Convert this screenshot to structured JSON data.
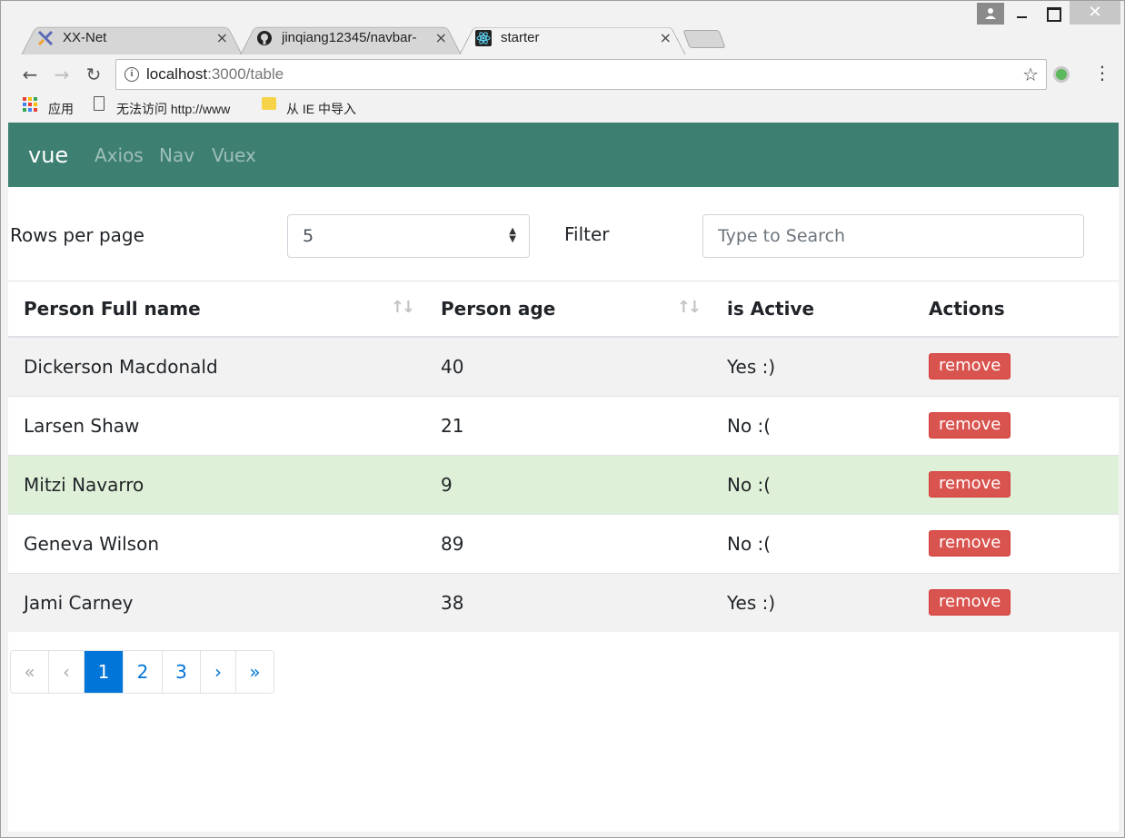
{
  "browser": {
    "tabs": [
      {
        "title": "XX-Net",
        "icon": "xx-net-logo-icon",
        "active": false
      },
      {
        "title": "jinqiang12345/navbar-",
        "icon": "github-icon",
        "active": false
      },
      {
        "title": "starter",
        "icon": "react-atom-icon",
        "active": true
      }
    ],
    "close_glyph": "×",
    "address": {
      "host": "localhost",
      "rest": ":3000/table"
    },
    "bookmarks": [
      {
        "label": "应用",
        "icon": "apps-grid-icon"
      },
      {
        "label": "无法访问 http://www",
        "icon": "page-icon"
      },
      {
        "label": "从 IE 中导入",
        "icon": "folder-icon"
      }
    ]
  },
  "navbar": {
    "brand": "vue",
    "links": [
      "Axios",
      "Nav",
      "Vuex"
    ],
    "color": "#3d7f71"
  },
  "controls": {
    "rows_per_page_label": "Rows per page",
    "rows_per_page_value": "5",
    "filter_label": "Filter",
    "search_placeholder": "Type to Search"
  },
  "table": {
    "headers": [
      "Person Full name",
      "Person age",
      "is Active",
      "Actions"
    ],
    "rows": [
      {
        "name": "Dickerson Macdonald",
        "age": "40",
        "active": "Yes :)",
        "action": "remove",
        "variant": "striped"
      },
      {
        "name": "Larsen Shaw",
        "age": "21",
        "active": "No :(",
        "action": "remove",
        "variant": "plain"
      },
      {
        "name": "Mitzi Navarro",
        "age": "9",
        "active": "No :(",
        "action": "remove",
        "variant": "success"
      },
      {
        "name": "Geneva Wilson",
        "age": "89",
        "active": "No :(",
        "action": "remove",
        "variant": "plain"
      },
      {
        "name": "Jami Carney",
        "age": "38",
        "active": "Yes :)",
        "action": "remove",
        "variant": "striped"
      }
    ]
  },
  "pagination": {
    "first": "«",
    "prev": "‹",
    "pages": [
      "1",
      "2",
      "3"
    ],
    "active_page": "1",
    "next": "›",
    "last": "»"
  },
  "colors": {
    "danger": "#d9534f",
    "primary": "#0275d8",
    "success_row": "#dff0d8",
    "striped_row": "#f2f2f2"
  }
}
